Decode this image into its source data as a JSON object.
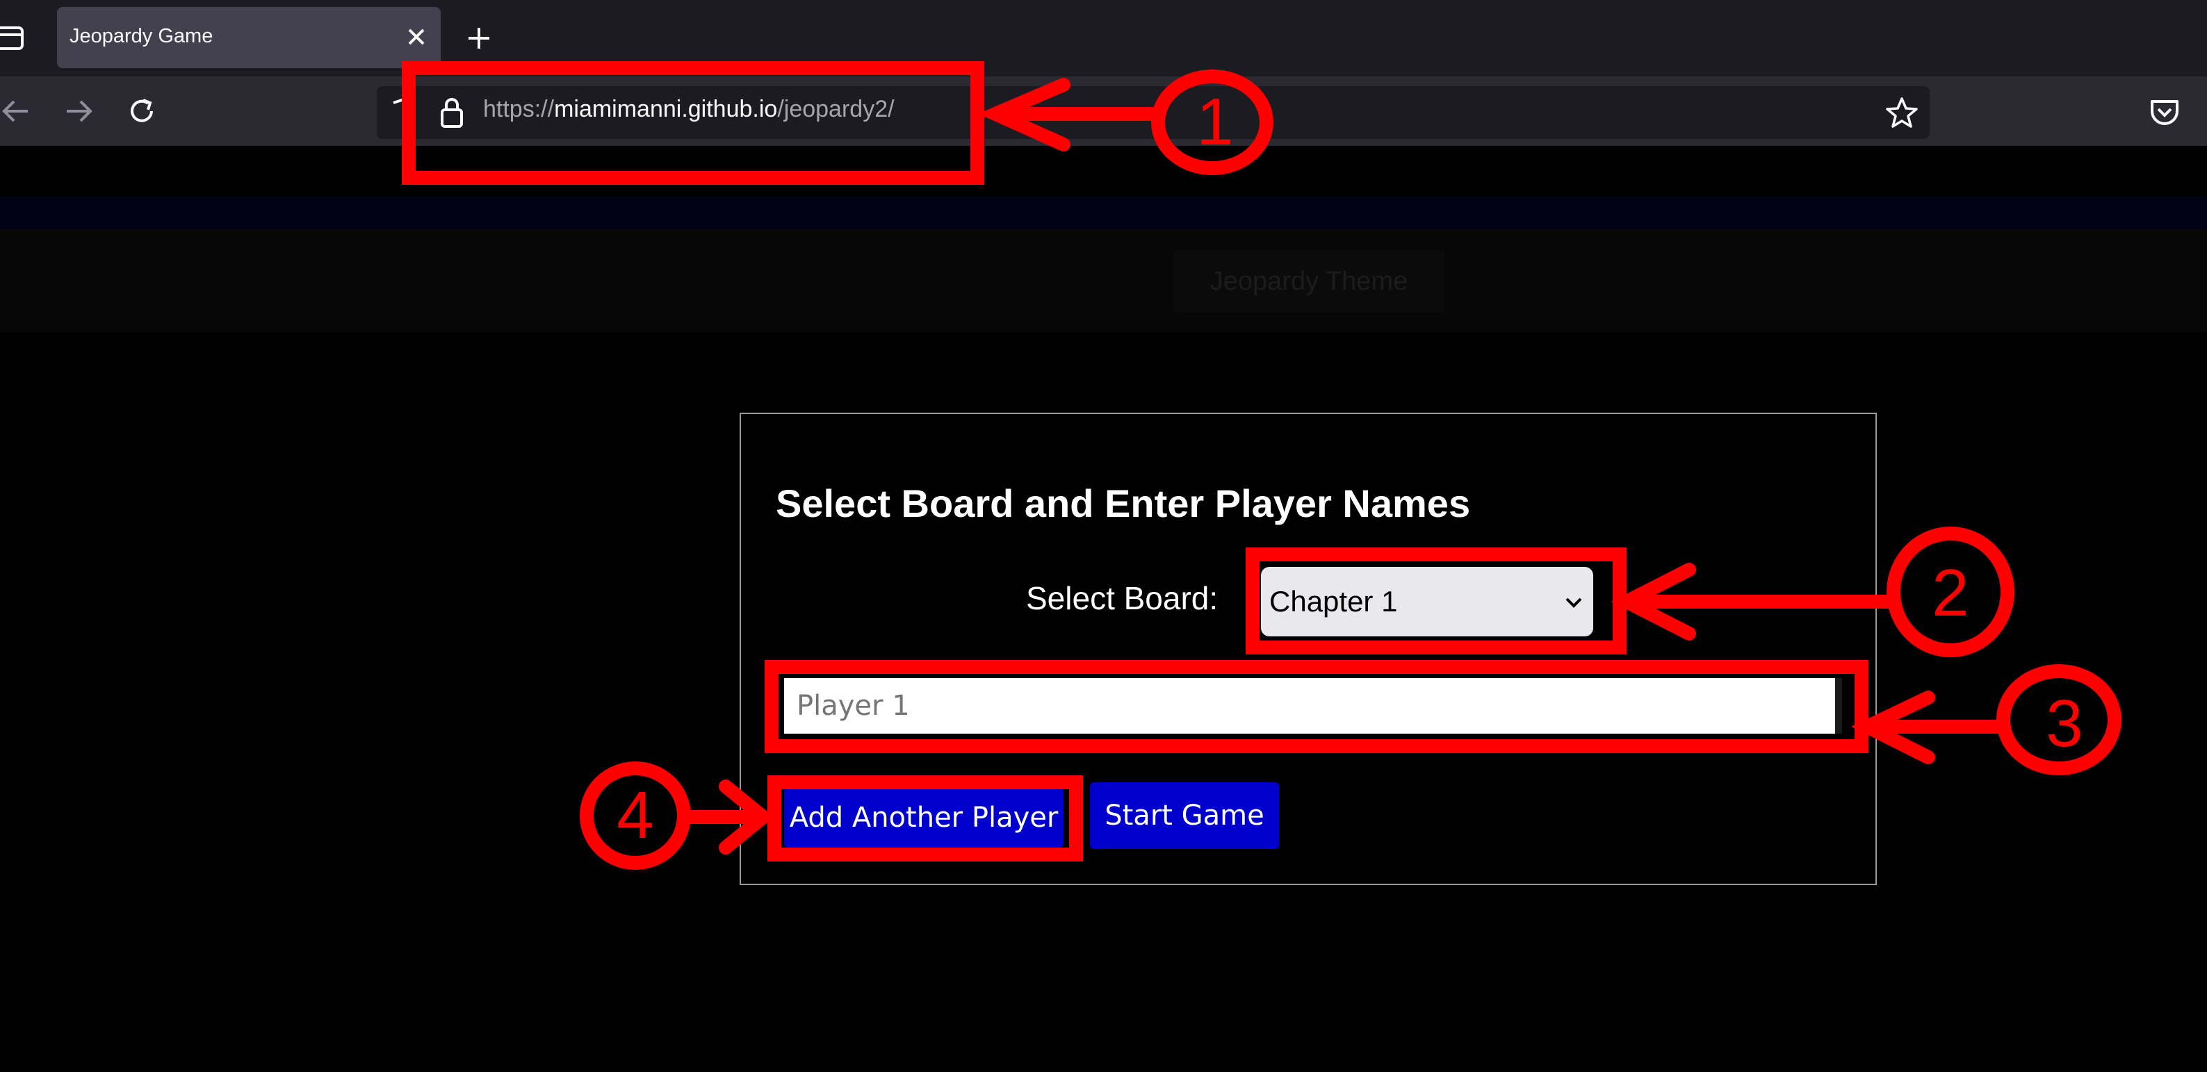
{
  "browser": {
    "tab_title": "Jeopardy Game",
    "url_prefix": "https://",
    "url_host": "miamimanni.github.io",
    "url_path": "/jeopardy2/"
  },
  "page": {
    "theme_button_label": "Jeopardy Theme",
    "setup_title": "Select Board and Enter Player Names",
    "select_label": "Select Board:",
    "selected_board": "Chapter 1",
    "player_placeholder": "Player 1",
    "add_player_label": "Add Another Player",
    "start_game_label": "Start Game"
  },
  "annotations": [
    "1",
    "2",
    "3",
    "4"
  ],
  "colors": {
    "annotation": "#ff0000",
    "button_blue": "#0000cc"
  }
}
